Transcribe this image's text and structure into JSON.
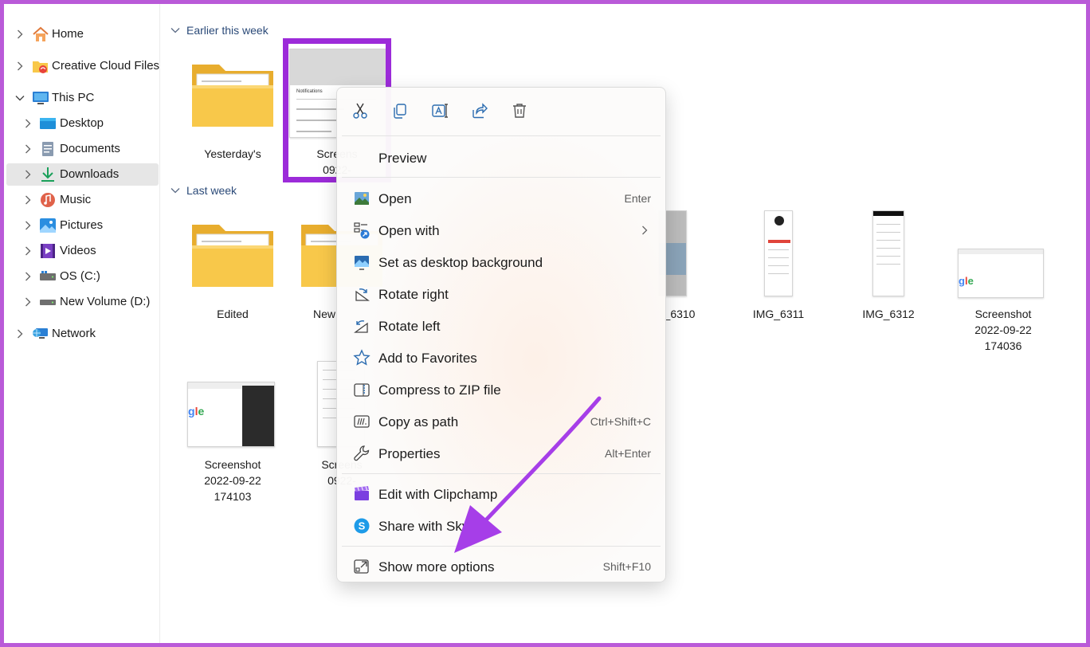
{
  "sidebar": {
    "items": [
      {
        "label": "Home",
        "icon": "home-icon"
      },
      {
        "label": "Creative Cloud Files",
        "icon": "creative-cloud-folder-icon"
      },
      {
        "label": "This PC",
        "icon": "computer-icon"
      },
      {
        "label": "Desktop",
        "icon": "desktop-icon"
      },
      {
        "label": "Documents",
        "icon": "documents-icon"
      },
      {
        "label": "Downloads",
        "icon": "downloads-icon",
        "selected": true
      },
      {
        "label": "Music",
        "icon": "music-icon"
      },
      {
        "label": "Pictures",
        "icon": "pictures-icon"
      },
      {
        "label": "Videos",
        "icon": "videos-icon"
      },
      {
        "label": "OS (C:)",
        "icon": "drive-icon"
      },
      {
        "label": "New Volume (D:)",
        "icon": "drive-icon"
      },
      {
        "label": "Network",
        "icon": "network-icon"
      }
    ]
  },
  "groups": {
    "earlier": "Earlier this week",
    "last": "Last week"
  },
  "files": {
    "yesterdays": "Yesterday's",
    "screens_sel_1": "Screens",
    "screens_sel_2": "0922-",
    "edited": "Edited",
    "new_partial": "New",
    "img6310": "_6310",
    "img6311": "IMG_6311",
    "img6312": "IMG_6312",
    "ss174036_1": "Screenshot",
    "ss174036_2": "2022-09-22",
    "ss174036_3": "174036",
    "ss174103_1": "Screenshot",
    "ss174103_2": "2022-09-22",
    "ss174103_3": "174103",
    "screens_b_1": "Screens",
    "screens_b_2": "0922-"
  },
  "thumb_text": {
    "notifications": "Notifications"
  },
  "context_menu": {
    "quick_actions": [
      "cut-icon",
      "copy-icon",
      "rename-icon",
      "share-icon",
      "delete-icon"
    ],
    "preview": "Preview",
    "items": [
      {
        "label": "Open",
        "shortcut": "Enter",
        "icon": "image-file-icon"
      },
      {
        "label": "Open with",
        "shortcut": "",
        "icon": "open-with-icon"
      },
      {
        "label": "Set as desktop background",
        "shortcut": "",
        "icon": "desktop-background-icon"
      },
      {
        "label": "Rotate right",
        "shortcut": "",
        "icon": "rotate-right-icon"
      },
      {
        "label": "Rotate left",
        "shortcut": "",
        "icon": "rotate-left-icon"
      },
      {
        "label": "Add to Favorites",
        "shortcut": "",
        "icon": "star-icon"
      },
      {
        "label": "Compress to ZIP file",
        "shortcut": "",
        "icon": "zip-icon"
      },
      {
        "label": "Copy as path",
        "shortcut": "Ctrl+Shift+C",
        "icon": "copy-path-icon"
      },
      {
        "label": "Properties",
        "shortcut": "Alt+Enter",
        "icon": "wrench-icon"
      },
      {
        "label": "Edit with Clipchamp",
        "shortcut": "",
        "icon": "clipchamp-icon"
      },
      {
        "label": "Share with Sky",
        "shortcut": "",
        "icon": "skype-icon"
      },
      {
        "label": "Show more options",
        "shortcut": "Shift+F10",
        "icon": "more-options-icon"
      }
    ]
  },
  "colors": {
    "accent_purple": "#9c2bd9",
    "folder_yellow": "#f8c84a",
    "selected_bg": "#e6e6e6"
  }
}
